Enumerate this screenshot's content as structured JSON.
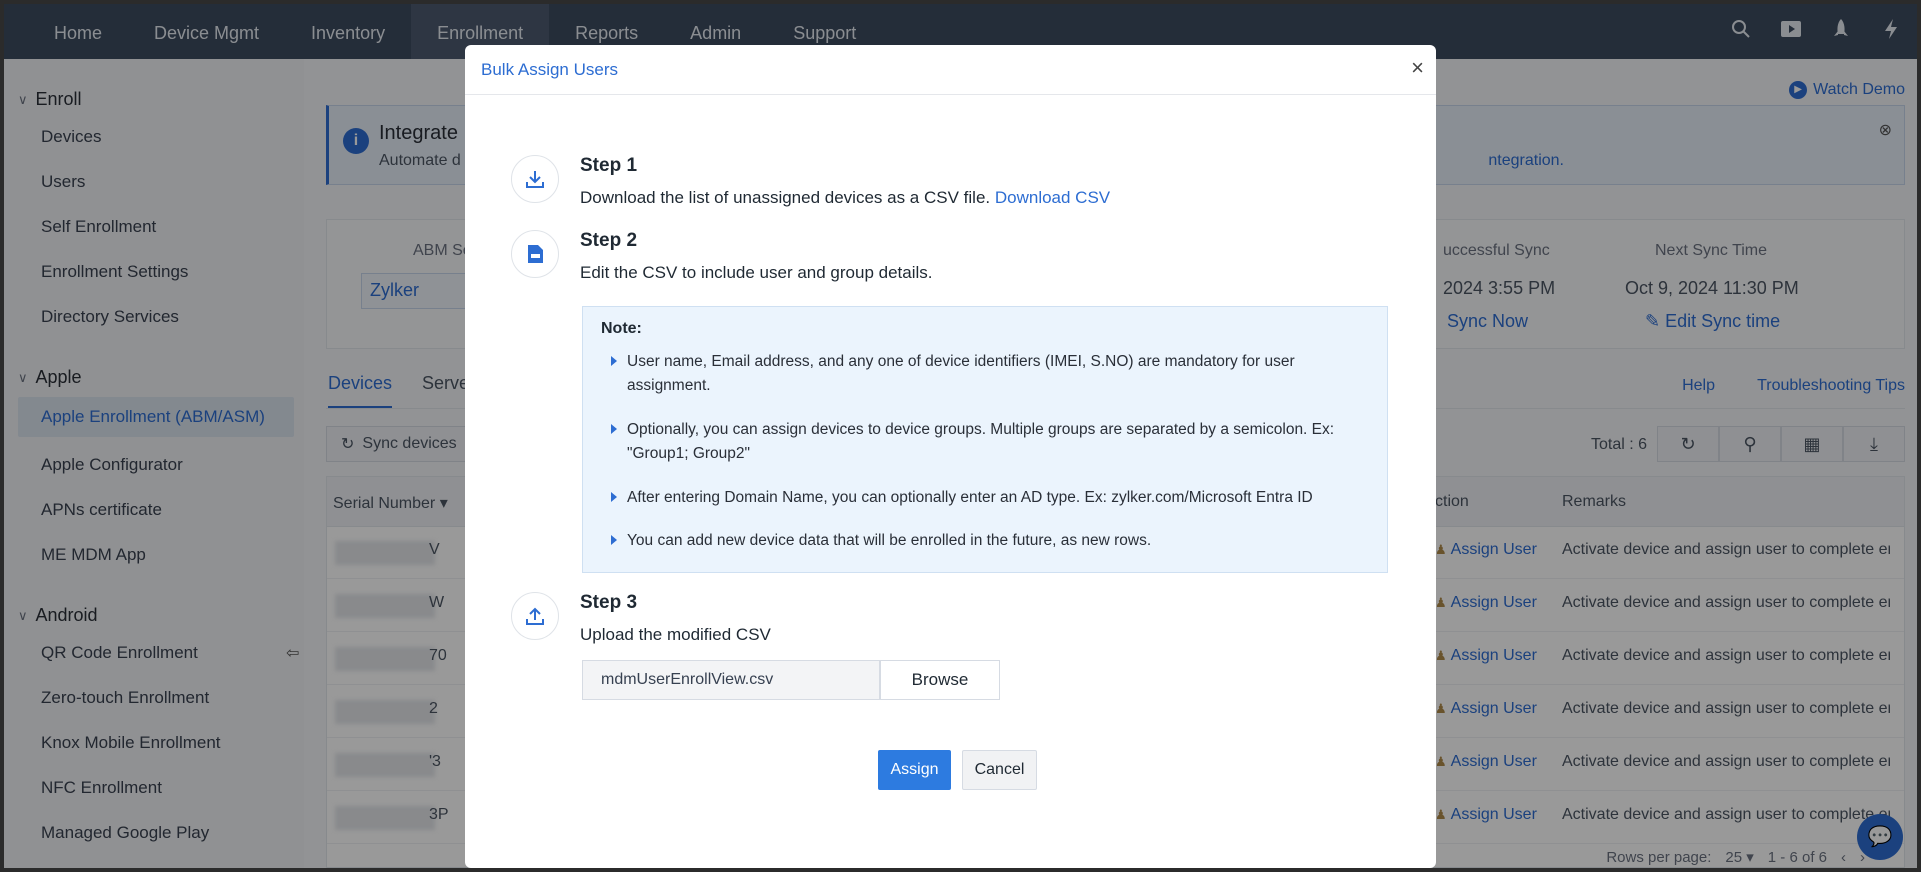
{
  "topnav": {
    "items": [
      "Home",
      "Device Mgmt",
      "Inventory",
      "Enrollment",
      "Reports",
      "Admin",
      "Support"
    ],
    "active": "Enrollment"
  },
  "sidebar": {
    "enroll": {
      "title": "Enroll",
      "items": [
        "Devices",
        "Users",
        "Self Enrollment",
        "Enrollment Settings",
        "Directory Services"
      ]
    },
    "apple": {
      "title": "Apple",
      "items": [
        "Apple Enrollment (ABM/ASM)",
        "Apple Configurator",
        "APNs certificate",
        "ME MDM App"
      ]
    },
    "android": {
      "title": "Android",
      "items": [
        "QR Code Enrollment",
        "Zero-touch Enrollment",
        "Knox Mobile Enrollment",
        "NFC Enrollment",
        "Managed Google Play"
      ]
    }
  },
  "main": {
    "watch_demo": "Watch Demo",
    "banner": {
      "title": "Integrate",
      "desc": "Automate d",
      "link": "ntegration."
    },
    "sync": {
      "abm_label": "ABM Se",
      "abm_value": "Zylker",
      "last_label": "uccessful Sync",
      "last_value": "2024 3:55 PM",
      "sync_now": "Sync Now",
      "next_label": "Next Sync Time",
      "next_value": "Oct 9, 2024 11:30 PM",
      "edit_sync": "Edit Sync time"
    },
    "tabs": [
      "Devices",
      "Server"
    ],
    "help": "Help",
    "troubleshooting": "Troubleshooting Tips",
    "sync_devices": "Sync devices",
    "total": "Total : 6",
    "table": {
      "col_serial": "Serial Number",
      "col_action": "ction",
      "col_remarks": "Remarks",
      "rows": [
        {
          "serial_tail": "V",
          "action": "Assign User",
          "remark": "Activate device and assign user to complete en"
        },
        {
          "serial_tail": "W",
          "action": "Assign User",
          "remark": "Activate device and assign user to complete en"
        },
        {
          "serial_tail": "70",
          "action": "Assign User",
          "remark": "Activate device and assign user to complete en"
        },
        {
          "serial_tail": "2",
          "action": "Assign User",
          "remark": "Activate device and assign user to complete en"
        },
        {
          "serial_tail": "'3",
          "action": "Assign User",
          "remark": "Activate device and assign user to complete en"
        },
        {
          "serial_tail": "3P",
          "action": "Assign User",
          "remark": "Activate device and assign user to complete en"
        }
      ]
    },
    "pager": {
      "rows_label": "Rows per page:",
      "rows_value": "25",
      "range": "1 - 6 of 6"
    }
  },
  "modal": {
    "title": "Bulk Assign Users",
    "step1": {
      "title": "Step 1",
      "desc": "Download the list of unassigned devices as a CSV file.",
      "link": "Download CSV"
    },
    "step2": {
      "title": "Step 2",
      "desc": "Edit the CSV to include user and group details.",
      "note_title": "Note:",
      "notes": [
        "User name, Email address, and any one of device identifiers (IMEI, S.NO) are mandatory for user assignment.",
        "Optionally, you can assign devices to device groups. Multiple groups are separated by a semicolon. Ex: \"Group1; Group2\"",
        "After entering Domain Name, you can optionally enter an AD type. Ex: zylker.com/Microsoft Entra ID",
        "You can add new device data that will be enrolled in the future, as new rows."
      ]
    },
    "step3": {
      "title": "Step 3",
      "desc": "Upload the modified CSV",
      "file_value": "mdmUserEnrollView.csv",
      "browse": "Browse"
    },
    "assign": "Assign",
    "cancel": "Cancel"
  }
}
